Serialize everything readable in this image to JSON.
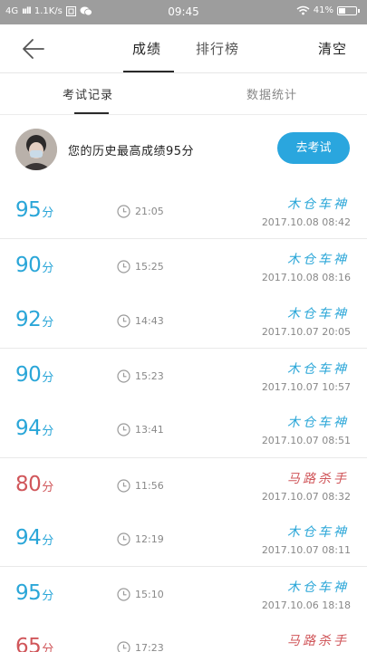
{
  "status_bar": {
    "network": "4G",
    "signal": "ııll",
    "speed": "1.1K/s",
    "time": "09:45",
    "battery_percent": "41%",
    "battery_level": 0.41
  },
  "header": {
    "tabs": [
      "成绩",
      "排行榜"
    ],
    "clear_label": "清空"
  },
  "subtabs": {
    "records": "考试记录",
    "stats": "数据统计"
  },
  "best": {
    "text": "您的历史最高成绩95分",
    "button": "去考试"
  },
  "colors": {
    "pass": "#2aa6d8",
    "fail": "#d0565a",
    "accent_button": "#2aa6de"
  },
  "records": [
    {
      "score": "95",
      "unit": "分",
      "duration": "21:05",
      "title": "木仓车神",
      "date": "2017.10.08  08:42",
      "status": "pass"
    },
    {
      "score": "90",
      "unit": "分",
      "duration": "15:25",
      "title": "木仓车神",
      "date": "2017.10.08  08:16",
      "status": "pass"
    },
    {
      "score": "92",
      "unit": "分",
      "duration": "14:43",
      "title": "木仓车神",
      "date": "2017.10.07  20:05",
      "status": "pass"
    },
    {
      "score": "90",
      "unit": "分",
      "duration": "15:23",
      "title": "木仓车神",
      "date": "2017.10.07  10:57",
      "status": "pass"
    },
    {
      "score": "94",
      "unit": "分",
      "duration": "13:41",
      "title": "木仓车神",
      "date": "2017.10.07  08:51",
      "status": "pass"
    },
    {
      "score": "80",
      "unit": "分",
      "duration": "11:56",
      "title": "马路杀手",
      "date": "2017.10.07  08:32",
      "status": "fail"
    },
    {
      "score": "94",
      "unit": "分",
      "duration": "12:19",
      "title": "木仓车神",
      "date": "2017.10.07  08:11",
      "status": "pass"
    },
    {
      "score": "95",
      "unit": "分",
      "duration": "15:10",
      "title": "木仓车神",
      "date": "2017.10.06  18:18",
      "status": "pass"
    },
    {
      "score": "65",
      "unit": "分",
      "duration": "17:23",
      "title": "马路杀手",
      "date": "",
      "status": "fail"
    }
  ]
}
